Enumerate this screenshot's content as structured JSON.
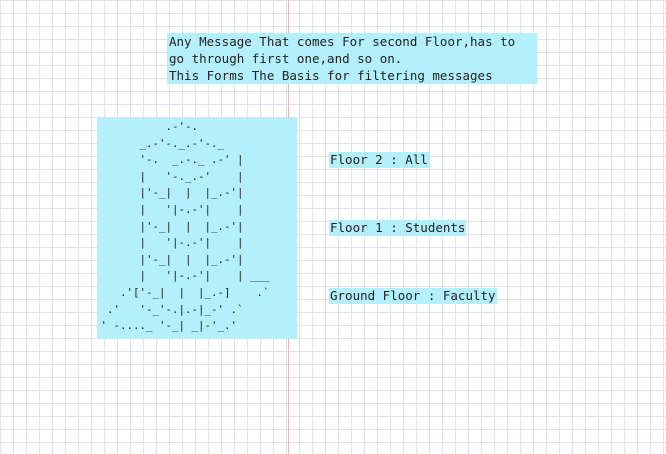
{
  "caption": {
    "lines": [
      "Any Message That comes For second Floor,has to",
      "go through first one,and so on.",
      "This Forms The Basis for filtering messages"
    ]
  },
  "tower": {
    "art": [
      "           .-'-.",
      "       _.-'-._.-'-._",
      "       '-.  _.-._ .-' |",
      "       |   '-._.-'    |",
      "       |'-_|  |  |_.-'|",
      "       |   '|-.-'|    |",
      "       |'-_|  |  |_.-'|",
      "       |   '|-.-'|    |",
      "       |'-_|  |  |_.-'|",
      "       |   '|-.-'|    | ___",
      "    .'['-_|  |  |_.-]    .`",
      "  .'   '-_'-.|.-|_-' .`",
      " ' -...._ '-_| _|-'_.'"
    ]
  },
  "floors": [
    "Floor 2 : All",
    "Floor 1 : Students",
    "Ground Floor : Faculty"
  ]
}
